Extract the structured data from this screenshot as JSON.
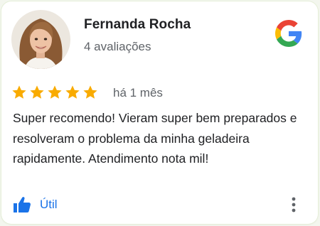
{
  "reviewer": {
    "name": "Fernanda Rocha",
    "review_count": "4 avaliações",
    "avatar_icon": "profile-photo"
  },
  "review": {
    "rating": 5,
    "max_rating": 5,
    "time_ago": "há 1 mês",
    "text": "Super recomendo! Vieram super bem preparados e resolveram o problema da minha geladeira rapidamente. Atendimento nota mil!"
  },
  "actions": {
    "helpful_label": "Útil",
    "helpful_icon": "thumbs-up-icon",
    "more_icon": "more-vert-icon"
  },
  "brand": {
    "logo": "google-g-logo",
    "colors": {
      "blue": "#4285F4",
      "red": "#EA4335",
      "yellow": "#FBBC05",
      "green": "#34A853",
      "star": "#F9AB00",
      "link": "#1a73e8"
    }
  }
}
